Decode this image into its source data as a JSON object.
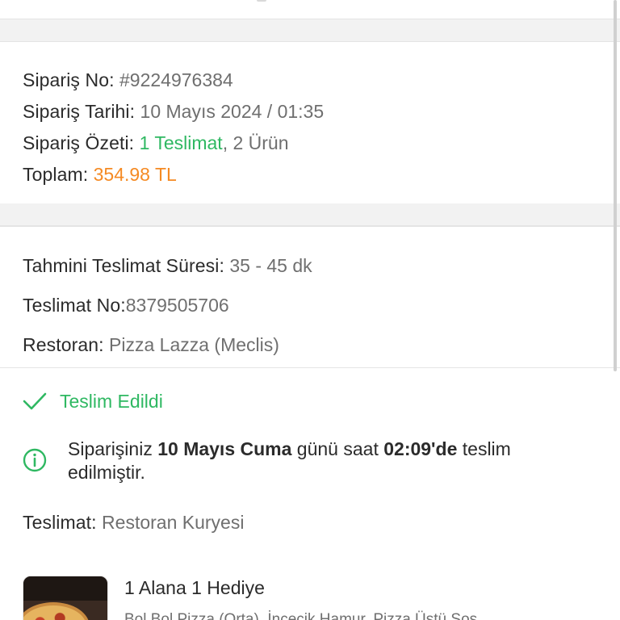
{
  "order": {
    "number_label": "Sipariş No:",
    "number_value": "#9224976384",
    "date_label": "Sipariş Tarihi:",
    "date_value": "10 Mayıs 2024 / 01:35",
    "summary_label": "Sipariş Özeti:",
    "summary_delivery": "1 Teslimat",
    "summary_sep": ",",
    "summary_items": " 2 Ürün",
    "total_label": "Toplam:",
    "total_value": "354.98 TL"
  },
  "delivery": {
    "eta_label": "Tahmini Teslimat Süresi:",
    "eta_value": "35 - 45 dk",
    "number_label": "Teslimat No:",
    "number_value": "8379505706",
    "restaurant_label": "Restoran:",
    "restaurant_value": "Pizza Lazza (Meclis)"
  },
  "status": {
    "label": "Teslim Edildi",
    "icon": "check-icon",
    "info_icon": "info-icon",
    "message_part1": "Siparişiniz ",
    "message_bold1": "10 Mayıs Cuma",
    "message_part2": " günü saat ",
    "message_bold2": "02:09'de",
    "message_part3": " teslim edilmiştir.",
    "carrier_label": "Teslimat:",
    "carrier_value": "Restoran Kuryesi"
  },
  "product": {
    "title": "1 Alana 1 Hediye",
    "description": "Bol Bol Pizza (Orta), İncecik Hamur, Pizza Üstü Sos"
  },
  "colors": {
    "accent_green": "#2fb862",
    "accent_orange": "#f58a23"
  }
}
